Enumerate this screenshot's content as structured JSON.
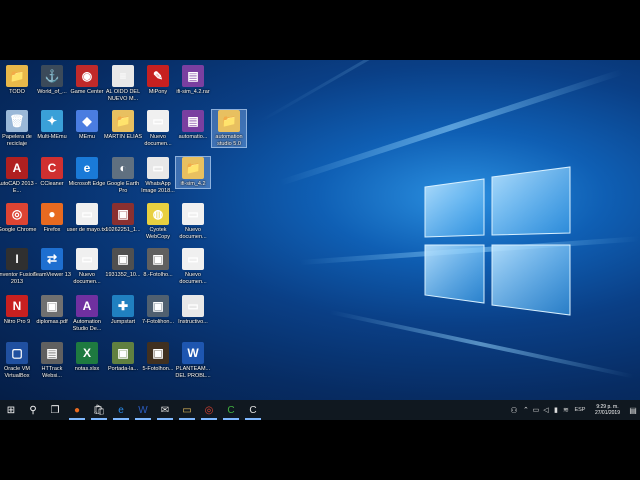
{
  "desktop": {
    "icons": [
      {
        "label": "TODO",
        "color": "#e8b84a",
        "glyph": "📁"
      },
      {
        "label": "World_of_...",
        "color": "#3b4a5a",
        "glyph": "⚓"
      },
      {
        "label": "Game Center",
        "color": "#c02a2a",
        "glyph": "◉"
      },
      {
        "label": "AL OIDO DEL NUEVO M...",
        "color": "#e8e8e8",
        "glyph": "≡"
      },
      {
        "label": "MiPony",
        "color": "#c62020",
        "glyph": "✎"
      },
      {
        "label": "ifi-sim_4.2.rar",
        "color": "#7a3fa0",
        "glyph": "▤"
      },
      {
        "label": "Papelera de reciclaje",
        "color": "#9ab8d8",
        "glyph": "🗑"
      },
      {
        "label": "Multi-MEmu",
        "color": "#3aa0d8",
        "glyph": "✦"
      },
      {
        "label": "MEmu",
        "color": "#4a7de0",
        "glyph": "◆"
      },
      {
        "label": "MARTIN ELIAS",
        "color": "#e8c060",
        "glyph": "📁"
      },
      {
        "label": "Nuevo documen...",
        "color": "#f0f0f0",
        "glyph": "▭"
      },
      {
        "label": "automatio...",
        "color": "#7a3fa0",
        "glyph": "▤"
      },
      {
        "label": "automation studio 5.0",
        "color": "#e8c060",
        "glyph": "📁"
      },
      {
        "label": "AutoCAD 2013 - E...",
        "color": "#b02020",
        "glyph": "A"
      },
      {
        "label": "CCleaner",
        "color": "#d03030",
        "glyph": "C"
      },
      {
        "label": "Microsoft Edge",
        "color": "#1a7ad8",
        "glyph": "e"
      },
      {
        "label": "Google Earth Pro",
        "color": "#607080",
        "glyph": "◐"
      },
      {
        "label": "WhatsApp Image 2018...",
        "color": "#e8e8e8",
        "glyph": "▭"
      },
      {
        "label": "ifi-sim_4.2",
        "color": "#e8c060",
        "glyph": "📁"
      },
      {
        "label": "Google Chrome",
        "color": "#dd4433",
        "glyph": "◎"
      },
      {
        "label": "Firefox",
        "color": "#e86a20",
        "glyph": "●"
      },
      {
        "label": "user de mayo.txt",
        "color": "#f0f0f0",
        "glyph": "▭"
      },
      {
        "label": "10262251_1...",
        "color": "#8a3030",
        "glyph": "▣"
      },
      {
        "label": "Cyotek WebCopy",
        "color": "#e8d040",
        "glyph": "◍"
      },
      {
        "label": "Nuevo documen...",
        "color": "#f0f0f0",
        "glyph": "▭"
      },
      {
        "label": "Inventor Fusion 2013",
        "color": "#303030",
        "glyph": "I"
      },
      {
        "label": "TeamViewer 13",
        "color": "#1e6fd0",
        "glyph": "⇄"
      },
      {
        "label": "Nuevo documen...",
        "color": "#f0f0f0",
        "glyph": "▭"
      },
      {
        "label": "1931352_10...",
        "color": "#505050",
        "glyph": "▣"
      },
      {
        "label": "8.-Fotolho...",
        "color": "#606060",
        "glyph": "▣"
      },
      {
        "label": "Nuevo documen...",
        "color": "#f0f0f0",
        "glyph": "▭"
      },
      {
        "label": "Nitro Pro 9",
        "color": "#c82020",
        "glyph": "N"
      },
      {
        "label": "diplomas.pdf",
        "color": "#707070",
        "glyph": "▣"
      },
      {
        "label": "Automation Studio De...",
        "color": "#7030a0",
        "glyph": "A"
      },
      {
        "label": "Jumpstart",
        "color": "#2080c0",
        "glyph": "✚"
      },
      {
        "label": "7-Fotolihon...",
        "color": "#506070",
        "glyph": "▣"
      },
      {
        "label": "Instructivo...",
        "color": "#e8e8e8",
        "glyph": "▭"
      },
      {
        "label": "Oracle VM VirtualBox",
        "color": "#2050a0",
        "glyph": "▢"
      },
      {
        "label": "HTTrack Websi...",
        "color": "#606060",
        "glyph": "▤"
      },
      {
        "label": "notas.xlsx",
        "color": "#1e7a40",
        "glyph": "X"
      },
      {
        "label": "Portada-la...",
        "color": "#608040",
        "glyph": "▣"
      },
      {
        "label": "5-Fotolhon...",
        "color": "#403020",
        "glyph": "▣"
      },
      {
        "label": "PLANTEAM... DEL PROBL...",
        "color": "#1e56b0",
        "glyph": "W"
      }
    ]
  },
  "taskbar": {
    "items": [
      {
        "name": "start-button",
        "glyph": "⊞",
        "color": "#ffffff"
      },
      {
        "name": "search-icon",
        "glyph": "⚲",
        "color": "#ffffff"
      },
      {
        "name": "task-view-icon",
        "glyph": "❐",
        "color": "#ffffff"
      },
      {
        "name": "firefox-taskbar-icon",
        "glyph": "●",
        "color": "#e86a20"
      },
      {
        "name": "store-taskbar-icon",
        "glyph": "🛍",
        "color": "#e0e0e0"
      },
      {
        "name": "edge-taskbar-icon",
        "glyph": "e",
        "color": "#2a8ae8"
      },
      {
        "name": "word-taskbar-icon",
        "glyph": "W",
        "color": "#2a5cc0"
      },
      {
        "name": "mail-taskbar-icon",
        "glyph": "✉",
        "color": "#e0e0e0"
      },
      {
        "name": "explorer-taskbar-icon",
        "glyph": "▭",
        "color": "#e8c060"
      },
      {
        "name": "chrome-taskbar-icon",
        "glyph": "◎",
        "color": "#dd4433"
      },
      {
        "name": "camtasia-taskbar-icon",
        "glyph": "C",
        "color": "#40b040"
      },
      {
        "name": "camtasia2-taskbar-icon",
        "glyph": "C",
        "color": "#e0e0e0"
      }
    ],
    "tray": {
      "lang": "ESP",
      "time": "9:29 p. m.",
      "date": "27/01/2019"
    }
  }
}
